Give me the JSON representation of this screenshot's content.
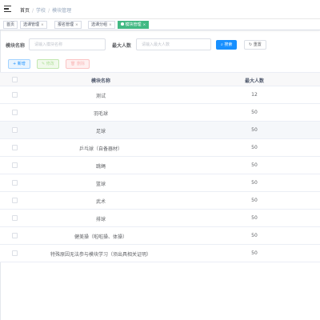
{
  "breadcrumb": [
    "首页",
    "学校",
    "模块管理"
  ],
  "tags": [
    {
      "label": "首页",
      "closable": false,
      "active": false
    },
    {
      "label": "选课管理",
      "closable": true,
      "active": false
    },
    {
      "label": "报名管理",
      "closable": true,
      "active": false
    },
    {
      "label": "选课分组",
      "closable": true,
      "active": false
    },
    {
      "label": "模块管理",
      "closable": true,
      "active": true
    }
  ],
  "search": {
    "name_label": "模块名称",
    "name_placeholder": "请输入模块名称",
    "max_label": "最大人数",
    "max_placeholder": "请输入最大人数",
    "search_button": "搜索",
    "reset_button": "重置"
  },
  "toolbar": {
    "add_button": "新增",
    "edit_button": "修改",
    "delete_button": "删除"
  },
  "table": {
    "columns": [
      "模块名称",
      "最大人数"
    ],
    "rows": [
      {
        "name": "测试",
        "max": "12"
      },
      {
        "name": "羽毛球",
        "max": "50"
      },
      {
        "name": "足球",
        "max": "50"
      },
      {
        "name": "乒乓球（自备器材）",
        "max": "50"
      },
      {
        "name": "跳绳",
        "max": "50"
      },
      {
        "name": "篮球",
        "max": "50"
      },
      {
        "name": "武术",
        "max": "50"
      },
      {
        "name": "排球",
        "max": "50"
      },
      {
        "name": "健美操（啦啦操、体操）",
        "max": "50"
      },
      {
        "name": "特殊原因无法参与模块学习（须出具相关证明）",
        "max": "50"
      }
    ]
  },
  "colors": {
    "primary": "#1890ff",
    "active_tag": "#42b983"
  },
  "icons": [
    "hamburger-icon",
    "search-icon",
    "refresh-icon",
    "plus-icon",
    "edit-icon",
    "delete-icon",
    "close-icon"
  ]
}
